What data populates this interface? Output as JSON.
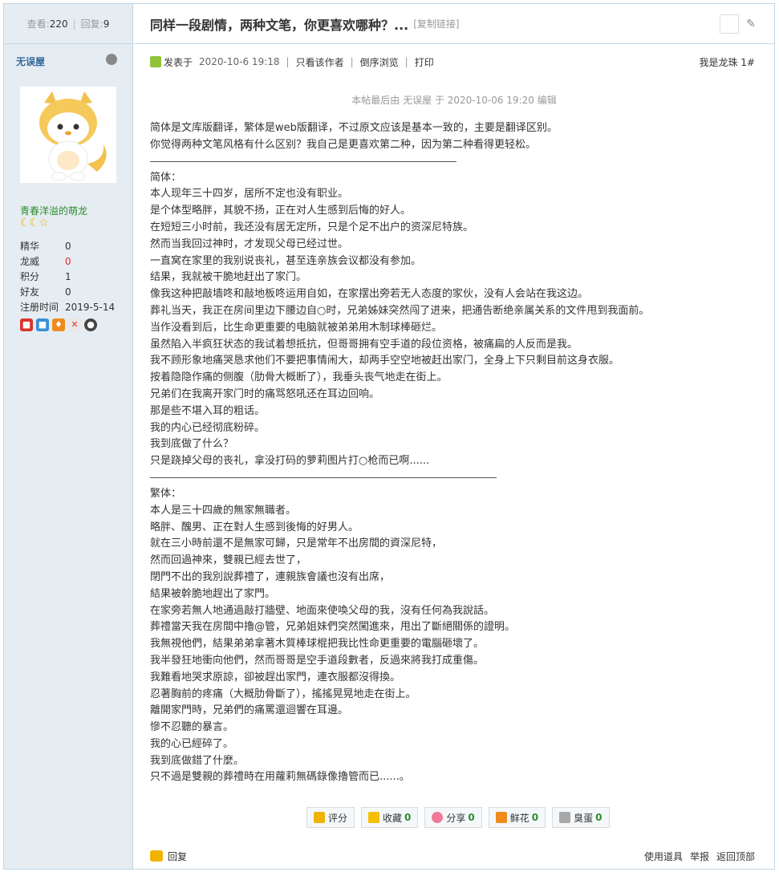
{
  "side": {
    "views_label": "查看:",
    "views": "220",
    "replies_label": "回复:",
    "replies": "9",
    "author": "无误屋",
    "rank": "青春洋溢的萌龙",
    "stars": "☾☾☆",
    "stats": [
      {
        "k": "精华",
        "v": "0",
        "red": false
      },
      {
        "k": "龙威",
        "v": "0",
        "red": true
      },
      {
        "k": "积分",
        "v": "1",
        "red": false
      },
      {
        "k": "好友",
        "v": "0",
        "red": false
      },
      {
        "k": "注册时间",
        "v": "2019-5-14",
        "red": false
      }
    ]
  },
  "thread": {
    "title": "同样一段剧情，两种文笔，你更喜欢哪种？...",
    "copy_link": "[复制链接]"
  },
  "meta": {
    "posted_label": "发表于",
    "date": "2020-10-6 19:18",
    "only_author": "只看该作者",
    "reverse": "倒序浏览",
    "print": "打印",
    "floor": "我是龙珠 1#"
  },
  "edit_note": "本帖最后由 无误屋 于 2020-10-06 19:20 编辑",
  "content": {
    "intro": [
      "简体是文库版翻译，繁体是web版翻译，不过原文应该是基本一致的，主要是翻译区别。",
      "你觉得两种文笔风格有什么区别？我自己是更喜欢第二种，因为第二种看得更轻松。"
    ],
    "simplified": [
      "简体：",
      "本人现年三十四岁，居所不定也没有职业。",
      "是个体型略胖，其貌不扬，正在对人生感到后悔的好人。",
      "在短短三小时前，我还没有居无定所，只是个足不出户的资深尼特族。",
      "然而当我回过神时，才发现父母已经过世。",
      "一直窝在家里的我别说丧礼，甚至连亲族会议都没有参加。",
      "结果，我就被干脆地赶出了家门。",
      "像我这种把敲墙咚和敲地板咚运用自如，在家摆出旁若无人态度的家伙，没有人会站在我这边。",
      "葬礼当天，我正在房间里边下腰边自○时，兄弟姊妹突然闯了进来，把通告断绝亲属关系的文件甩到我面前。",
      "当作没看到后，比生命更重要的电脑就被弟弟用木制球棒砸烂。",
      "虽然陷入半疯狂状态的我试着想抵抗，但哥哥拥有空手道的段位资格，被痛扁的人反而是我。",
      "我不顾形象地痛哭恳求他们不要把事情闹大，却两手空空地被赶出家门，全身上下只剩目前这身衣服。",
      "按着隐隐作痛的侧腹（肋骨大概断了），我垂头丧气地走在街上。",
      "兄弟们在我离开家门时的痛骂怒吼还在耳边回响。",
      "那是些不堪入耳的粗话。",
      "我的内心已经彻底粉碎。",
      "我到底做了什么？",
      "只是跷掉父母的丧礼，拿没打码的萝莉图片打○枪而已啊......"
    ],
    "traditional": [
      "繁体：",
      "本人是三十四歲的無家無職者。",
      "略胖、醜男、正在對人生感到後悔的好男人。",
      "就在三小時前還不是無家可歸，只是常年不出房間的資深尼特，",
      "然而回過神來，雙親已經去世了，",
      "閉門不出的我別說葬禮了，連親族會議也沒有出席，",
      "結果被幹脆地趕出了家門。",
      "在家旁若無人地通過敲打牆壁、地面來使喚父母的我，沒有任何為我說話。",
      "葬禮當天我在房間中擼@管，兄弟姐妹們突然闖進來，甩出了斷絕關係的證明。",
      "我無視他們，結果弟弟拿著木質棒球棍把我比性命更重要的電腦砸壞了。",
      "我半發狂地衝向他們，然而哥哥是空手道段數者，反過來將我打成重傷。",
      "我難看地哭求原諒，卻被趕出家門，連衣服都沒得換。",
      "忍著胸前的疼痛（大概肋骨斷了），搖搖晃晃地走在街上。",
      "離開家門時，兄弟們的痛罵還迴響在耳邊。",
      "慘不忍聽的暴言。",
      "我的心已經碎了。",
      "我到底做錯了什麼。",
      "只不過是雙親的葬禮時在用蘿莉無碼錄像擼管而已......。"
    ]
  },
  "actions": {
    "rate": "评分",
    "fav": "收藏",
    "fav_count": "0",
    "share": "分享",
    "share_count": "0",
    "flower": "鲜花",
    "flower_count": "0",
    "egg": "臭蛋",
    "egg_count": "0"
  },
  "footer": {
    "reply": "回复",
    "tools": "使用道具",
    "report": "举报",
    "top": "返回顶部"
  }
}
